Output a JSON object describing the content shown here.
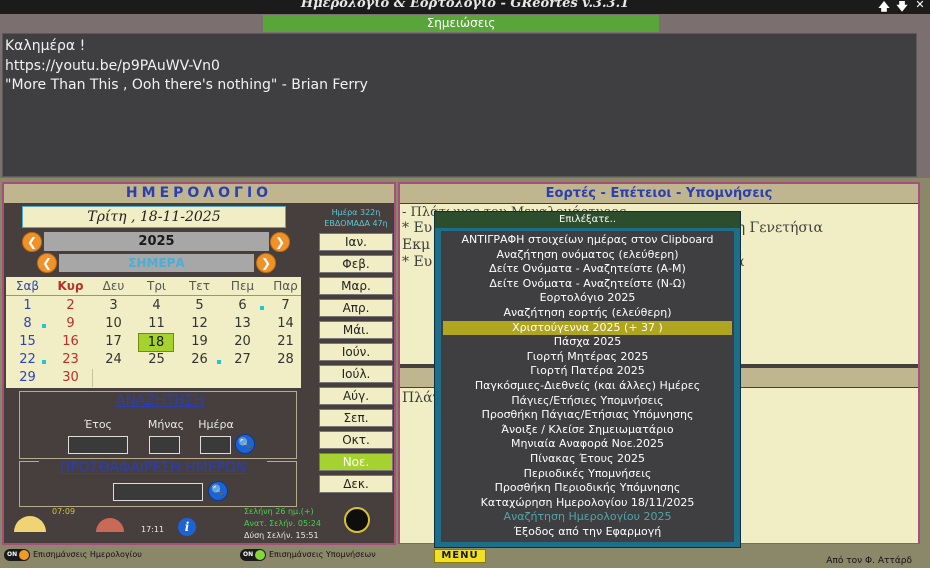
{
  "window": {
    "title": "Ημερολόγιο & Εορτολόγιο - GReortes v.3.3.1",
    "up_glyph": "🡅",
    "down_glyph": "🡇",
    "close_glyph": "✕"
  },
  "notes": {
    "header": "Σημειώσεις",
    "lines": [
      "Καλημέρα !",
      "https://youtu.be/p9PAuWV-Vn0",
      "\"More Than This , Ooh there's nothing\" - Brian Ferry"
    ]
  },
  "calendar": {
    "header": "ΗΜΕΡΟΛΟΓΙΟ",
    "date_display": "Τρίτη , 18-11-2025",
    "day_of_year": "Ημέρα 322η",
    "week": "ΕΒΔΟΜΑΔΑ 47η",
    "year": "2025",
    "today_label": "ΣΗΜΕΡΑ",
    "prev_glyph": "❮",
    "next_glyph": "❯",
    "weekdays": [
      "Σαβ",
      "Κυρ",
      "Δευ",
      "Τρι",
      "Τετ",
      "Πεμ",
      "Παρ"
    ],
    "weeks": [
      [
        "1",
        "2",
        "3",
        "4",
        "5",
        "6",
        "7"
      ],
      [
        "8",
        "9",
        "10",
        "11",
        "12",
        "13",
        "14"
      ],
      [
        "15",
        "16",
        "17",
        "18",
        "19",
        "20",
        "21"
      ],
      [
        "22",
        "23",
        "24",
        "25",
        "26",
        "27",
        "28"
      ],
      [
        "29",
        "30",
        "",
        "",
        "",
        "",
        ""
      ]
    ],
    "today_day": "18",
    "months": [
      "Ιαν.",
      "Φεβ.",
      "Μαρ.",
      "Απρ.",
      "Μάι.",
      "Ιούν.",
      "Ιούλ.",
      "Αύγ.",
      "Σεπ.",
      "Οκτ.",
      "Νοε.",
      "Δεκ."
    ],
    "active_month": "Νοε."
  },
  "search": {
    "title": "ΑΝΑΖΗΤΗΣΗ",
    "year_label": "Έτος",
    "month_label": "Μήνας",
    "day_label": "Ημέρα",
    "button_glyph": "🔍"
  },
  "addsub": {
    "title": "ΠΡΟΣΘΑΦΑΙΡΕΣΗ ΗΜΕΡΩΝ",
    "button_glyph": "🔍"
  },
  "sun": {
    "sunrise": "07:09",
    "sunset": "17:11"
  },
  "moon": {
    "phase": "Σελήνη 26 ημ.(+)",
    "rise": "Ανατ. Σελήν. 05:24",
    "set": "Δύση Σελήν. 15:51"
  },
  "info_glyph": "i",
  "celebrations": {
    "header": "Εορτές - Επέτειοι - Υπομνήσεις",
    "lines": [
      "- Πλάτωνος του Μεγαλομάρτυρος",
      "* Ευ                                                   διών από τη Γενετήσια",
      "Εκμ",
      "* Ευ                                                   Αντιβιοτικά"
    ]
  },
  "reminders": {
    "text": "Πλάτ"
  },
  "menu": {
    "title": "Επιλέξατε..",
    "items": [
      "ΑΝΤΙΓΡΑΦΗ στοιχείων ημέρας στον Clipboard",
      "Αναζήτηση ονόματος (ελεύθερη)",
      "Δείτε Ονόματα - Αναζητείστε (Α-Μ)",
      "Δείτε Ονόματα - Αναζητείστε (Ν-Ω)",
      "Εορτολόγιο 2025",
      "Αναζήτηση εορτής (ελεύθερη)",
      "Χριστούγεννα 2025  (+ 37 )",
      "Πάσχα 2025",
      "Γιορτή Μητέρας 2025",
      "Γιορτή Πατέρα 2025",
      "Παγκόσμιες-Διεθνείς (και άλλες) Ημέρες",
      "Πάγιες/Ετήσιες Υπομνήσεις",
      "Προσθήκη Πάγιας/Ετήσιας Υπόμνησης",
      "Άνοιξε / Κλείσε Σημειωματάριο",
      "Μηνιαία Αναφορά Νοε.2025",
      "Πίνακας Έτους 2025",
      "Περιοδικές Υπομνήσεις",
      "Προσθήκη Περιοδικής Υπόμνησης",
      "Καταχώρηση Ημερολογίου 18/11/2025",
      "Αναζήτηση Ημερολογίου 2025",
      "Έξοδος από την Εφαρμογή"
    ],
    "selected_index": 6,
    "dimmed_index": 19
  },
  "status": {
    "cal_marks_label": "Επισημάνσεις Ημερολογίου",
    "rem_marks_label": "Επισημάνσεις Υπομνήσεων",
    "toggle_on": "ON",
    "menu_button": "MENU",
    "author": "Από τον Φ. Αττάρδ"
  },
  "colors": {
    "accent_green": "#a5d22e",
    "menu_selected": "#b0a51e",
    "panel_border": "#a64e7c",
    "title_blue": "#2b3fb0",
    "mark_cyan": "#1ec6d6",
    "toggle_dot_orange": "#f09a2a",
    "toggle_dot_green": "#86d63a"
  }
}
